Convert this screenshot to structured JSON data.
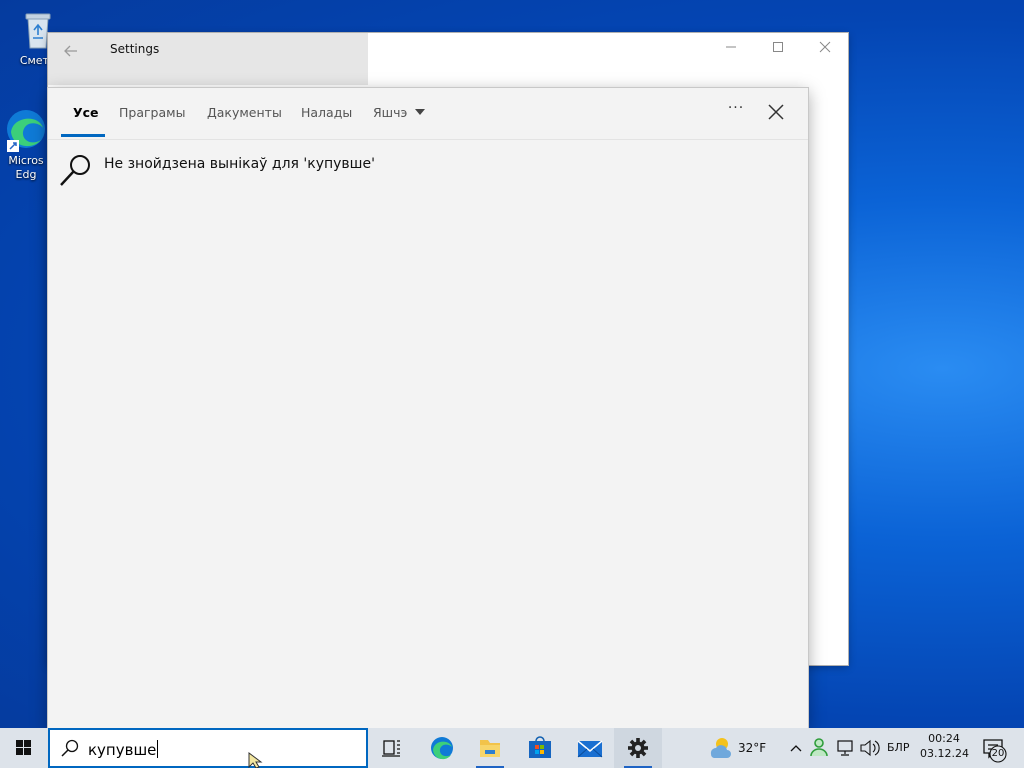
{
  "desktop": {
    "icons": [
      {
        "label": "Сметн",
        "icon": "recycle-bin-icon"
      },
      {
        "label": "Micros\nEdg",
        "icon": "edge-icon"
      }
    ]
  },
  "settings_window": {
    "title": "Settings",
    "back_icon": "back-arrow-icon",
    "minimize_glyph": "—",
    "maximize_glyph": "☐",
    "close_glyph": "✕"
  },
  "search_panel": {
    "tabs": [
      {
        "label": "Усе",
        "active": true
      },
      {
        "label": "Праграмы",
        "active": false
      },
      {
        "label": "Дакументы",
        "active": false
      },
      {
        "label": "Налады",
        "active": false
      },
      {
        "label": "Яшчэ",
        "active": false
      }
    ],
    "more_glyph": "···",
    "no_results_text": "Не знойдзена вынікаў для 'купувше'",
    "accent": "#0067c0"
  },
  "taskbar": {
    "search_value": "купувше",
    "apps": [
      {
        "name": "task-view",
        "icon": "task-view-icon"
      },
      {
        "name": "edge",
        "icon": "edge-icon"
      },
      {
        "name": "file-explorer",
        "icon": "folder-icon"
      },
      {
        "name": "store",
        "icon": "store-icon"
      },
      {
        "name": "mail",
        "icon": "mail-icon"
      },
      {
        "name": "settings",
        "icon": "gear-icon",
        "active": true
      }
    ],
    "weather": "32°F",
    "language": "БЛР",
    "time": "00:24",
    "date": "03.12.24",
    "notifications_count": "20"
  }
}
